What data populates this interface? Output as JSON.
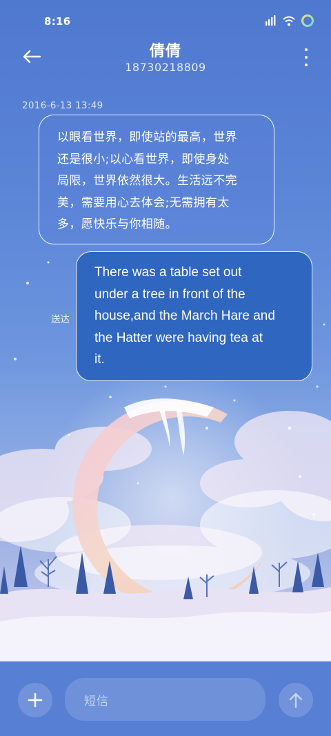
{
  "status_bar": {
    "time": "8:16"
  },
  "header": {
    "contact_name": "倩倩",
    "contact_number": "18730218809"
  },
  "messages": [
    {
      "direction": "incoming",
      "timestamp": "2016-6-13 13:49",
      "text": "以眼看世界，即使站的最高，世界\n还是很小;以心看世界，即使身处\n局限，世界依然很大。生活远不完\n美，需要用心去体会;无需拥有太\n多，愿快乐与你相随。"
    },
    {
      "direction": "outgoing",
      "status": "送达",
      "text": "There was a table set out\nunder a tree in front of the\nhouse,and the March Hare and\nthe Hatter were having tea at\nit."
    }
  ],
  "input_bar": {
    "placeholder": "短信"
  },
  "icons": {
    "back": "back-arrow-icon",
    "more": "more-vertical-icon",
    "add": "plus-icon",
    "send": "send-arrow-icon",
    "signal": "signal-icon",
    "wifi": "wifi-icon",
    "battery": "battery-ring-icon"
  },
  "colors": {
    "outgoing_bubble": "#2e66c0",
    "input_bar": "#577fd4",
    "battery_ring_start": "#f5e26b",
    "battery_ring_end": "#6fd6e8"
  }
}
